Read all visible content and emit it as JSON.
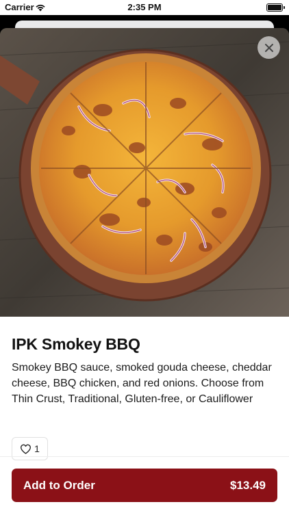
{
  "status_bar": {
    "carrier": "Carrier",
    "time": "2:35 PM",
    "wifi_icon": "wifi-icon",
    "battery_icon": "battery-icon"
  },
  "hero": {
    "image": "pizza-photo",
    "close_icon": "close-icon"
  },
  "product": {
    "name": "IPK Smokey BBQ",
    "description": "Smokey BBQ sauce, smoked gouda cheese, cheddar cheese, BBQ chicken, and red onions. Choose from Thin Crust, Traditional, Gluten-free, or Cauliflower",
    "like_count": "1",
    "like_icon": "heart-icon"
  },
  "footer": {
    "add_label": "Add to Order",
    "price": "$13.49"
  },
  "colors": {
    "primary": "#8b1117",
    "background": "#ffffff",
    "text": "#111111"
  }
}
